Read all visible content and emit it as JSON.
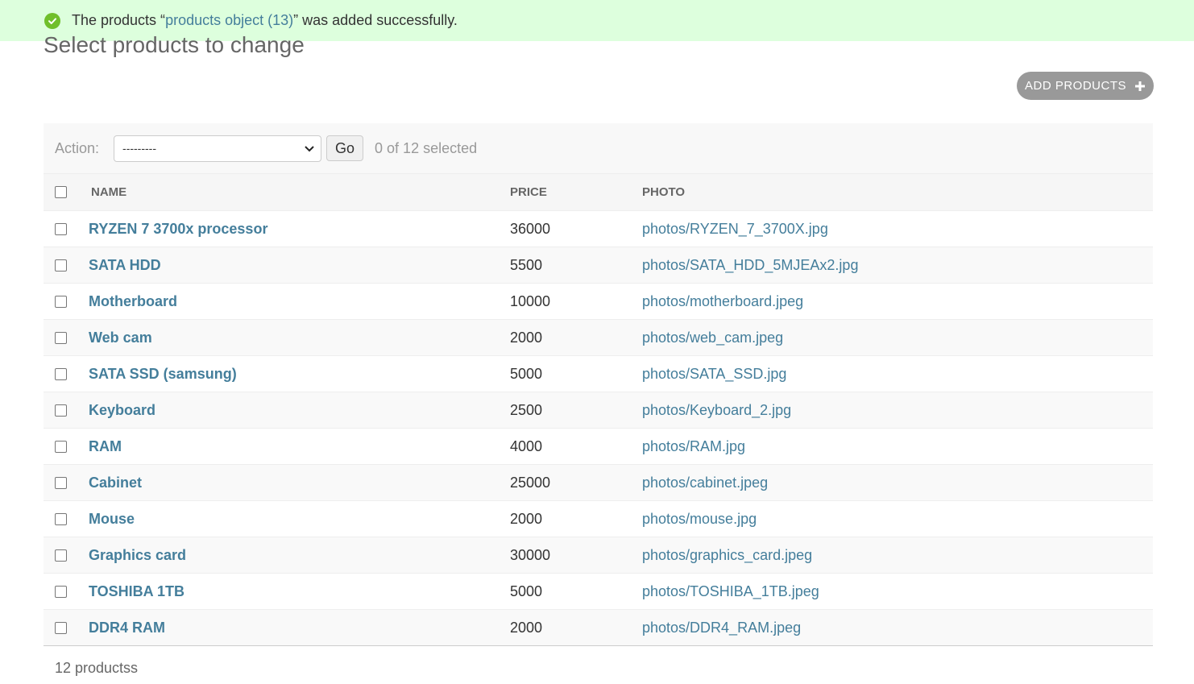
{
  "messages": {
    "success_prefix": "The products “",
    "success_link": "products object (13)",
    "success_suffix": "” was added successfully."
  },
  "page": {
    "title": "Select products to change",
    "add_button_label": "ADD PRODUCTS"
  },
  "actions": {
    "label": "Action:",
    "selected_option": "---------",
    "go_label": "Go",
    "counter": "0 of 12 selected"
  },
  "table": {
    "headers": [
      "NAME",
      "PRICE",
      "PHOTO"
    ],
    "rows": [
      {
        "name": "RYZEN 7 3700x processor",
        "price": "36000",
        "photo": "photos/RYZEN_7_3700X.jpg"
      },
      {
        "name": "SATA HDD",
        "price": "5500",
        "photo": "photos/SATA_HDD_5MJEAx2.jpg"
      },
      {
        "name": "Motherboard",
        "price": "10000",
        "photo": "photos/motherboard.jpeg"
      },
      {
        "name": "Web cam",
        "price": "2000",
        "photo": "photos/web_cam.jpeg"
      },
      {
        "name": "SATA SSD (samsung)",
        "price": "5000",
        "photo": "photos/SATA_SSD.jpg"
      },
      {
        "name": "Keyboard",
        "price": "2500",
        "photo": "photos/Keyboard_2.jpg"
      },
      {
        "name": "RAM",
        "price": "4000",
        "photo": "photos/RAM.jpg"
      },
      {
        "name": "Cabinet",
        "price": "25000",
        "photo": "photos/cabinet.jpeg"
      },
      {
        "name": "Mouse",
        "price": "2000",
        "photo": "photos/mouse.jpg"
      },
      {
        "name": "Graphics card",
        "price": "30000",
        "photo": "photos/graphics_card.jpeg"
      },
      {
        "name": "TOSHIBA 1TB",
        "price": "5000",
        "photo": "photos/TOSHIBA_1TB.jpeg"
      },
      {
        "name": "DDR4 RAM",
        "price": "2000",
        "photo": "photos/DDR4_RAM.jpeg"
      }
    ]
  },
  "footer": {
    "count": "12 productss"
  },
  "colors": {
    "success_bg": "#ddffdd",
    "link": "#447e9b",
    "success_icon": "#70bf2b"
  }
}
